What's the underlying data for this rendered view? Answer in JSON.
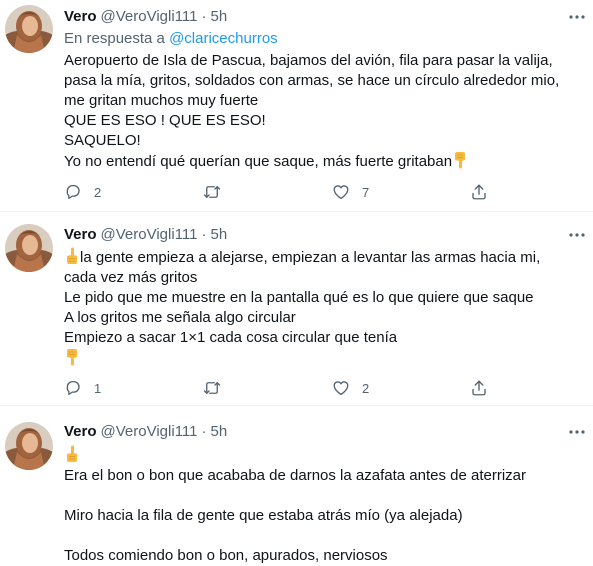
{
  "tweets": [
    {
      "name": "Vero",
      "handle": "@VeroVigli111",
      "dot": "·",
      "time": "5h",
      "reply_prefix": "En respuesta a",
      "reply_mention": "@claricechurros",
      "lines": [
        "Aeropuerto de Isla de Pascua, bajamos del avión, fila para pasar la valija,",
        "pasa la mía, gritos, soldados con armas, se hace un círculo alrededor mio,",
        "me gritan muchos muy fuerte",
        "QUE ES ESO ! QUE ES ESO!",
        "SAQUELO!",
        "Yo no entendí qué querían que saque, más fuerte gritaban"
      ],
      "reply_count": "2",
      "retweet_count": "",
      "like_count": "7"
    },
    {
      "name": "Vero",
      "handle": "@VeroVigli111",
      "dot": "·",
      "time": "5h",
      "lines": [
        "la gente empieza a alejarse, empiezan a levantar las armas hacia mi,",
        "cada vez más gritos",
        "Le pido que me muestre en la pantalla qué es lo que quiere que saque",
        "A los gritos me señala algo circular",
        "Empiezo a sacar 1×1 cada cosa circular que tenía"
      ],
      "reply_count": "1",
      "retweet_count": "",
      "like_count": "2"
    },
    {
      "name": "Vero",
      "handle": "@VeroVigli111",
      "dot": "·",
      "time": "5h",
      "lines": [
        "Era el bon o bon que acababa de darnos la azafata antes de aterrizar",
        "",
        "Miro hacia la fila de gente que estaba atrás mío (ya alejada)",
        "",
        "Todos comiendo bon o bon, apurados, nerviosos"
      ]
    }
  ],
  "icons": {
    "more": "more-horizontal-icon",
    "reply": "reply-bubble-icon",
    "retweet": "retweet-icon",
    "like": "heart-icon",
    "share": "share-icon",
    "emoji_down": "backhand-index-pointing-down-emoji",
    "emoji_up": "backhand-index-pointing-up-emoji"
  },
  "colors": {
    "text": "#0f1419",
    "secondary": "#536471",
    "link": "#1d9bf0",
    "divider": "#eff3f4",
    "emoji": "#f7b93e"
  }
}
